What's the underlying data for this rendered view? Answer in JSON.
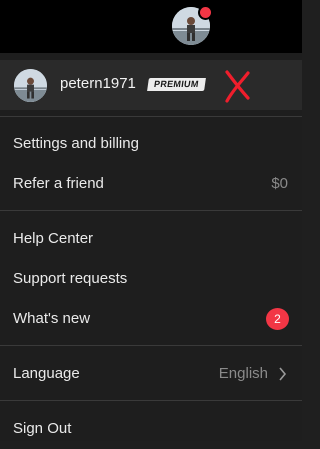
{
  "header": {
    "avatar_icon": "user-avatar-photo",
    "notification_color": "#f23645"
  },
  "profile": {
    "username": "petern1971",
    "plan_badge": "PREMIUM",
    "annotation_icon": "red-x-mark"
  },
  "menu": {
    "settings_label": "Settings and billing",
    "refer_label": "Refer a friend",
    "refer_value": "$0",
    "help_label": "Help Center",
    "support_label": "Support requests",
    "whatsnew_label": "What's new",
    "whatsnew_count": "2",
    "language_label": "Language",
    "language_value": "English",
    "signout_label": "Sign Out"
  },
  "colors": {
    "badge_red": "#f23645",
    "menu_bg": "#1e1e1e",
    "profile_bg": "#2a2a2a",
    "topbar_bg": "#000000"
  }
}
